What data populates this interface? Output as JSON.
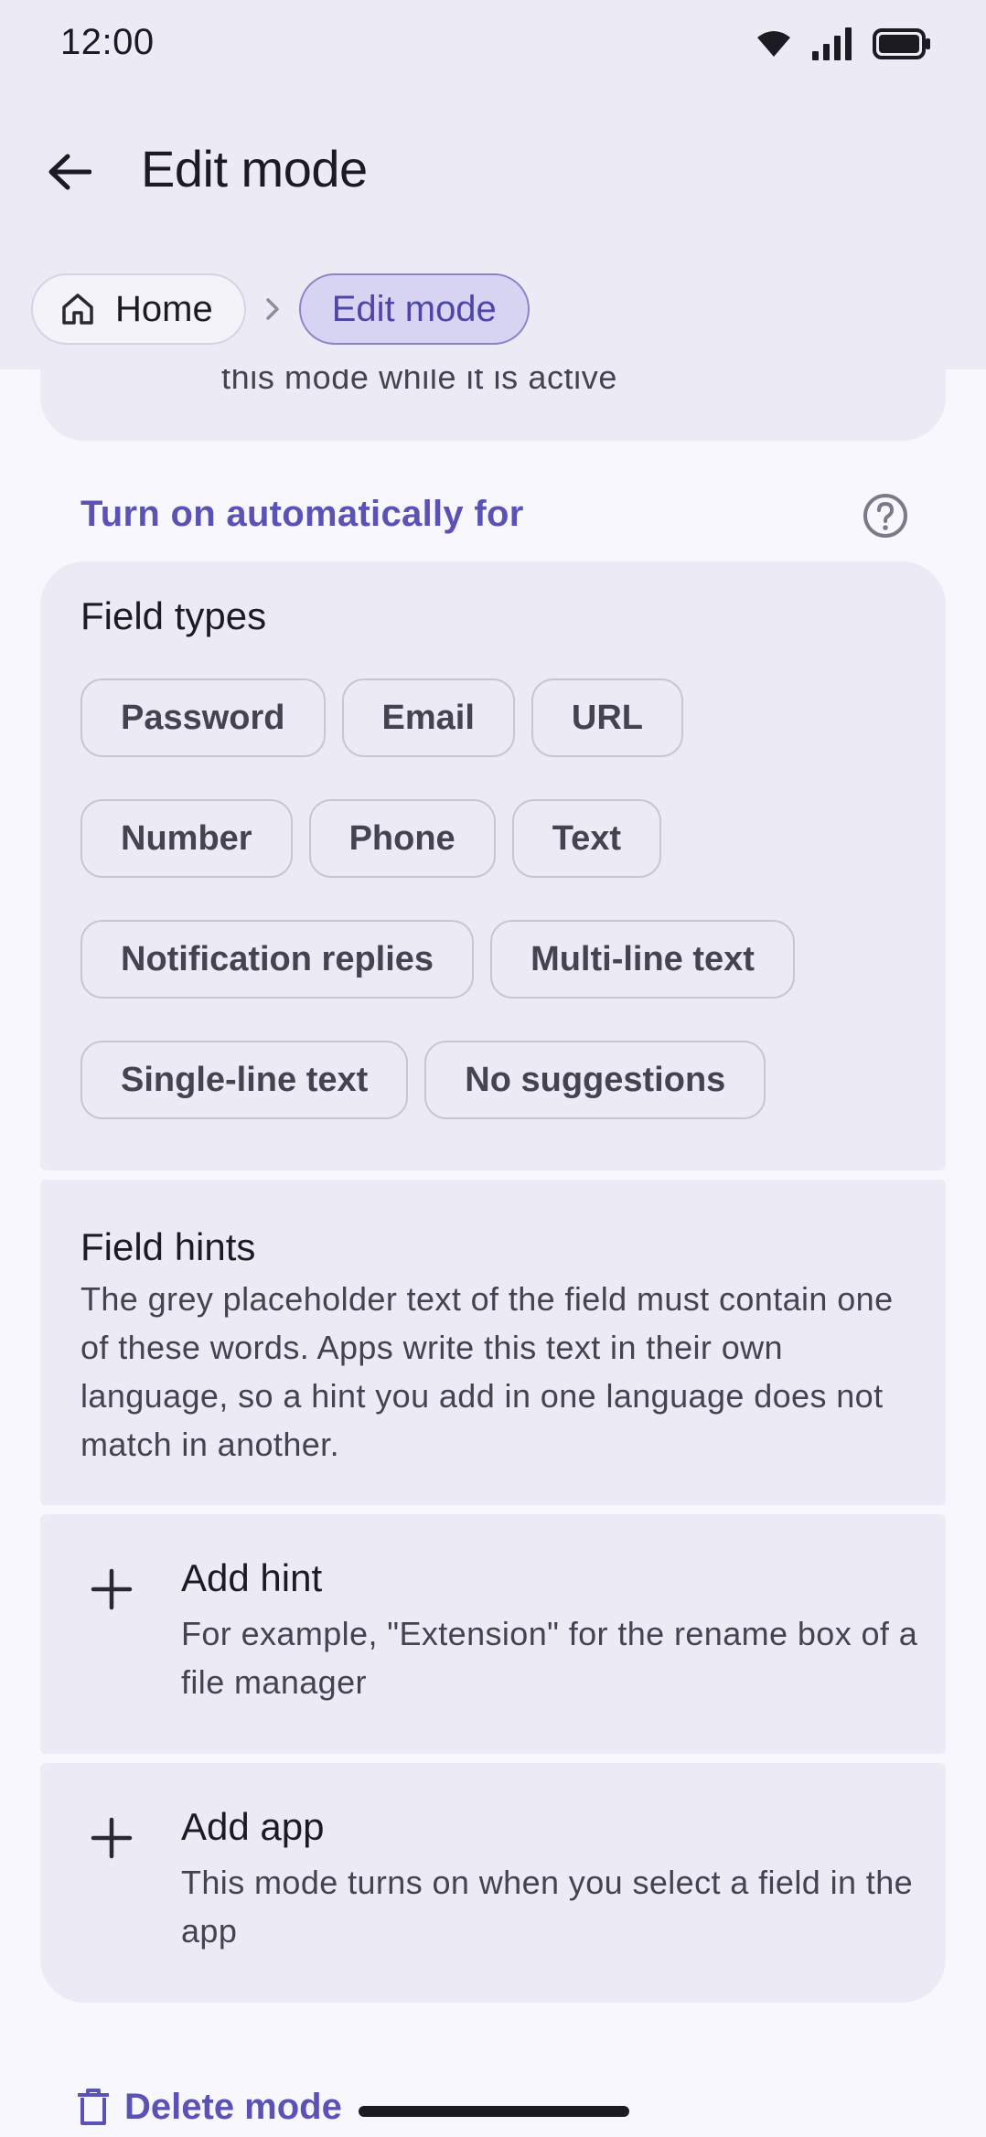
{
  "status_bar": {
    "time": "12:00",
    "icons": [
      "wifi-icon",
      "signal-icon",
      "battery-icon"
    ]
  },
  "app_bar": {
    "title": "Edit mode",
    "back_icon": "arrow-left-icon"
  },
  "breadcrumb": {
    "items": [
      {
        "label": "Home",
        "icon": "home-icon"
      },
      {
        "label": "Edit mode"
      }
    ],
    "separator_icon": "chevron-right-icon"
  },
  "previous_card": {
    "partial_text": "this mode while it is active"
  },
  "auto_section": {
    "title": "Turn on automatically for",
    "help_icon": "help-circle-icon"
  },
  "field_types": {
    "heading": "Field types",
    "rows": [
      [
        "Password",
        "Email",
        "URL"
      ],
      [
        "Number",
        "Phone",
        "Text"
      ],
      [
        "Notification replies",
        "Multi-line text"
      ],
      [
        "Single-line text",
        "No suggestions"
      ]
    ]
  },
  "field_hints": {
    "heading": "Field hints",
    "description": "The grey placeholder text of the field must contain one of these words. Apps write this text in their own language, so a hint you add in one language does not match in another."
  },
  "add_hint": {
    "title": "Add hint",
    "description": "For example, \"Extension\" for the rename box of a file manager"
  },
  "add_app": {
    "title": "Add app",
    "description": "This mode turns on when you select a field in the app"
  },
  "delete": {
    "label": "Delete mode",
    "icon": "trash-icon"
  },
  "colors": {
    "accent": "#5b52b6",
    "surface": "#ecebf5",
    "background": "#f8f7fd",
    "chip_selected_bg": "#d6d4f2"
  }
}
